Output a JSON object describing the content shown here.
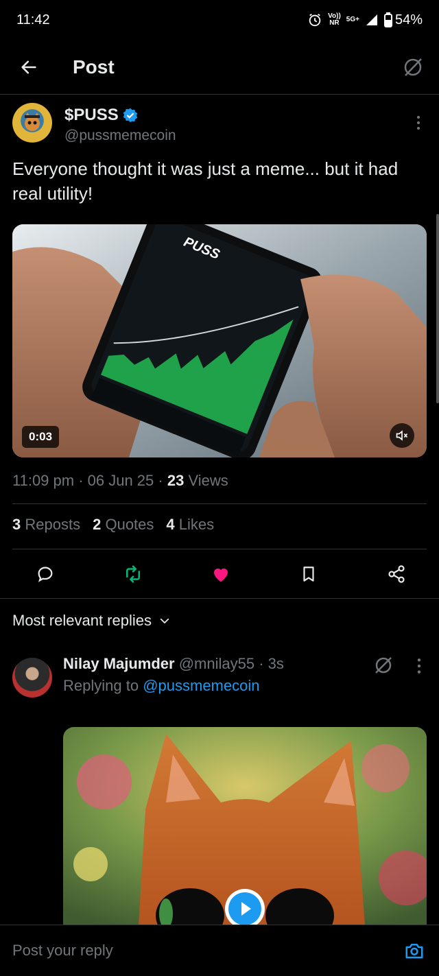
{
  "status_bar": {
    "time": "11:42",
    "network_top": "Vo))",
    "network_bottom": "NR",
    "signal_label": "5G+",
    "battery": "54%"
  },
  "header": {
    "title": "Post"
  },
  "post": {
    "author_name": "$PUSS",
    "author_handle": "@pussmemecoin",
    "text": "Everyone thought it was just a meme... but it had real utility!",
    "video_time": "0:03",
    "timestamp": "11:09 pm · 06 Jun 25 · ",
    "views_count": "23",
    "views_label": " Views",
    "stats": [
      {
        "count": "3",
        "label": "Reposts"
      },
      {
        "count": "2",
        "label": "Quotes"
      },
      {
        "count": "4",
        "label": "Likes"
      }
    ]
  },
  "sort": {
    "label": "Most relevant replies"
  },
  "reply": {
    "name": "Nilay Majumder",
    "handle_time": " @mnilay55 · 3s",
    "replying_prefix": "Replying to ",
    "replying_handle": "@pussmemecoin"
  },
  "compose": {
    "placeholder": "Post your reply"
  },
  "colors": {
    "accent": "#1d9bf0",
    "like": "#f91880",
    "repost": "#00ba7c",
    "background": "#000000",
    "divider": "#2f3336",
    "muted_text": "#71767b"
  }
}
